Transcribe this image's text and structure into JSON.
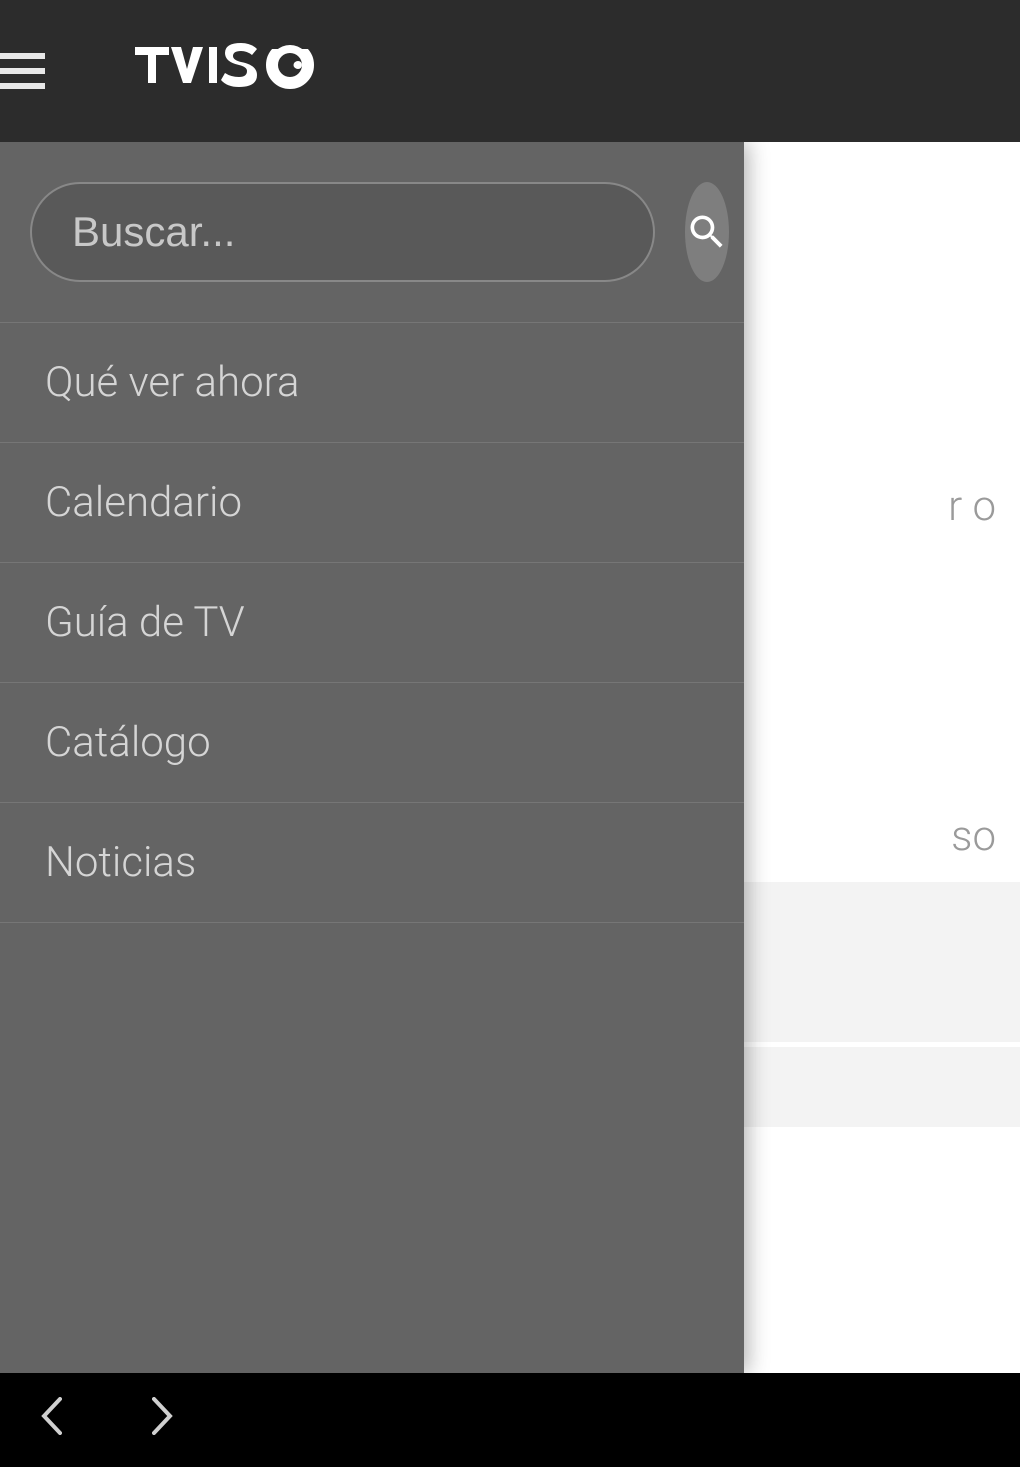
{
  "header": {
    "logo_text": "TVISO"
  },
  "sidebar": {
    "search_placeholder": "Buscar...",
    "menu_items": [
      {
        "label": "Qué ver ahora"
      },
      {
        "label": "Calendario"
      },
      {
        "label": "Guía de TV"
      },
      {
        "label": "Catálogo"
      },
      {
        "label": "Noticias"
      }
    ]
  },
  "background": {
    "text_fragment_1": "r o",
    "text_fragment_2": "so"
  }
}
